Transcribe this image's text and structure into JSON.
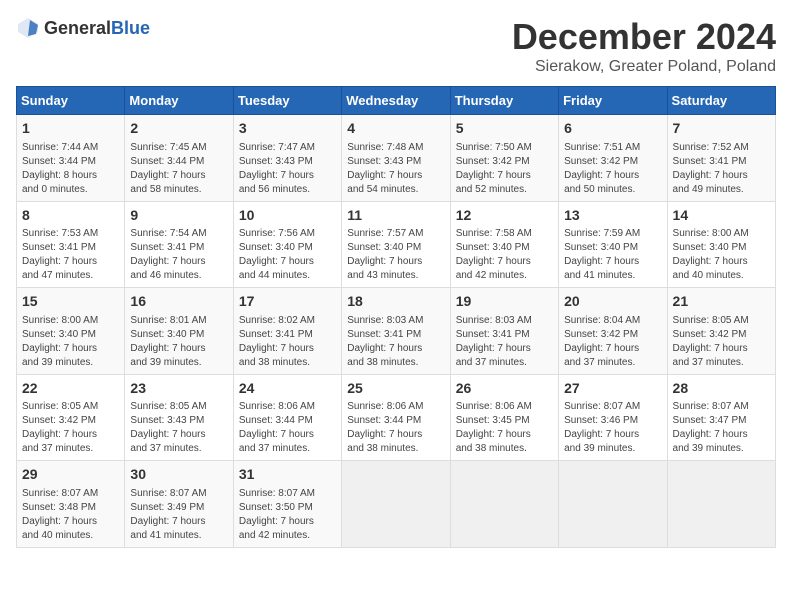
{
  "logo": {
    "general": "General",
    "blue": "Blue"
  },
  "header": {
    "title": "December 2024",
    "subtitle": "Sierakow, Greater Poland, Poland"
  },
  "weekdays": [
    "Sunday",
    "Monday",
    "Tuesday",
    "Wednesday",
    "Thursday",
    "Friday",
    "Saturday"
  ],
  "weeks": [
    [
      {
        "day": "1",
        "sunrise": "Sunrise: 7:44 AM",
        "sunset": "Sunset: 3:44 PM",
        "daylight": "Daylight: 8 hours and 0 minutes."
      },
      {
        "day": "2",
        "sunrise": "Sunrise: 7:45 AM",
        "sunset": "Sunset: 3:44 PM",
        "daylight": "Daylight: 7 hours and 58 minutes."
      },
      {
        "day": "3",
        "sunrise": "Sunrise: 7:47 AM",
        "sunset": "Sunset: 3:43 PM",
        "daylight": "Daylight: 7 hours and 56 minutes."
      },
      {
        "day": "4",
        "sunrise": "Sunrise: 7:48 AM",
        "sunset": "Sunset: 3:43 PM",
        "daylight": "Daylight: 7 hours and 54 minutes."
      },
      {
        "day": "5",
        "sunrise": "Sunrise: 7:50 AM",
        "sunset": "Sunset: 3:42 PM",
        "daylight": "Daylight: 7 hours and 52 minutes."
      },
      {
        "day": "6",
        "sunrise": "Sunrise: 7:51 AM",
        "sunset": "Sunset: 3:42 PM",
        "daylight": "Daylight: 7 hours and 50 minutes."
      },
      {
        "day": "7",
        "sunrise": "Sunrise: 7:52 AM",
        "sunset": "Sunset: 3:41 PM",
        "daylight": "Daylight: 7 hours and 49 minutes."
      }
    ],
    [
      {
        "day": "8",
        "sunrise": "Sunrise: 7:53 AM",
        "sunset": "Sunset: 3:41 PM",
        "daylight": "Daylight: 7 hours and 47 minutes."
      },
      {
        "day": "9",
        "sunrise": "Sunrise: 7:54 AM",
        "sunset": "Sunset: 3:41 PM",
        "daylight": "Daylight: 7 hours and 46 minutes."
      },
      {
        "day": "10",
        "sunrise": "Sunrise: 7:56 AM",
        "sunset": "Sunset: 3:40 PM",
        "daylight": "Daylight: 7 hours and 44 minutes."
      },
      {
        "day": "11",
        "sunrise": "Sunrise: 7:57 AM",
        "sunset": "Sunset: 3:40 PM",
        "daylight": "Daylight: 7 hours and 43 minutes."
      },
      {
        "day": "12",
        "sunrise": "Sunrise: 7:58 AM",
        "sunset": "Sunset: 3:40 PM",
        "daylight": "Daylight: 7 hours and 42 minutes."
      },
      {
        "day": "13",
        "sunrise": "Sunrise: 7:59 AM",
        "sunset": "Sunset: 3:40 PM",
        "daylight": "Daylight: 7 hours and 41 minutes."
      },
      {
        "day": "14",
        "sunrise": "Sunrise: 8:00 AM",
        "sunset": "Sunset: 3:40 PM",
        "daylight": "Daylight: 7 hours and 40 minutes."
      }
    ],
    [
      {
        "day": "15",
        "sunrise": "Sunrise: 8:00 AM",
        "sunset": "Sunset: 3:40 PM",
        "daylight": "Daylight: 7 hours and 39 minutes."
      },
      {
        "day": "16",
        "sunrise": "Sunrise: 8:01 AM",
        "sunset": "Sunset: 3:40 PM",
        "daylight": "Daylight: 7 hours and 39 minutes."
      },
      {
        "day": "17",
        "sunrise": "Sunrise: 8:02 AM",
        "sunset": "Sunset: 3:41 PM",
        "daylight": "Daylight: 7 hours and 38 minutes."
      },
      {
        "day": "18",
        "sunrise": "Sunrise: 8:03 AM",
        "sunset": "Sunset: 3:41 PM",
        "daylight": "Daylight: 7 hours and 38 minutes."
      },
      {
        "day": "19",
        "sunrise": "Sunrise: 8:03 AM",
        "sunset": "Sunset: 3:41 PM",
        "daylight": "Daylight: 7 hours and 37 minutes."
      },
      {
        "day": "20",
        "sunrise": "Sunrise: 8:04 AM",
        "sunset": "Sunset: 3:42 PM",
        "daylight": "Daylight: 7 hours and 37 minutes."
      },
      {
        "day": "21",
        "sunrise": "Sunrise: 8:05 AM",
        "sunset": "Sunset: 3:42 PM",
        "daylight": "Daylight: 7 hours and 37 minutes."
      }
    ],
    [
      {
        "day": "22",
        "sunrise": "Sunrise: 8:05 AM",
        "sunset": "Sunset: 3:42 PM",
        "daylight": "Daylight: 7 hours and 37 minutes."
      },
      {
        "day": "23",
        "sunrise": "Sunrise: 8:05 AM",
        "sunset": "Sunset: 3:43 PM",
        "daylight": "Daylight: 7 hours and 37 minutes."
      },
      {
        "day": "24",
        "sunrise": "Sunrise: 8:06 AM",
        "sunset": "Sunset: 3:44 PM",
        "daylight": "Daylight: 7 hours and 37 minutes."
      },
      {
        "day": "25",
        "sunrise": "Sunrise: 8:06 AM",
        "sunset": "Sunset: 3:44 PM",
        "daylight": "Daylight: 7 hours and 38 minutes."
      },
      {
        "day": "26",
        "sunrise": "Sunrise: 8:06 AM",
        "sunset": "Sunset: 3:45 PM",
        "daylight": "Daylight: 7 hours and 38 minutes."
      },
      {
        "day": "27",
        "sunrise": "Sunrise: 8:07 AM",
        "sunset": "Sunset: 3:46 PM",
        "daylight": "Daylight: 7 hours and 39 minutes."
      },
      {
        "day": "28",
        "sunrise": "Sunrise: 8:07 AM",
        "sunset": "Sunset: 3:47 PM",
        "daylight": "Daylight: 7 hours and 39 minutes."
      }
    ],
    [
      {
        "day": "29",
        "sunrise": "Sunrise: 8:07 AM",
        "sunset": "Sunset: 3:48 PM",
        "daylight": "Daylight: 7 hours and 40 minutes."
      },
      {
        "day": "30",
        "sunrise": "Sunrise: 8:07 AM",
        "sunset": "Sunset: 3:49 PM",
        "daylight": "Daylight: 7 hours and 41 minutes."
      },
      {
        "day": "31",
        "sunrise": "Sunrise: 8:07 AM",
        "sunset": "Sunset: 3:50 PM",
        "daylight": "Daylight: 7 hours and 42 minutes."
      },
      null,
      null,
      null,
      null
    ]
  ]
}
